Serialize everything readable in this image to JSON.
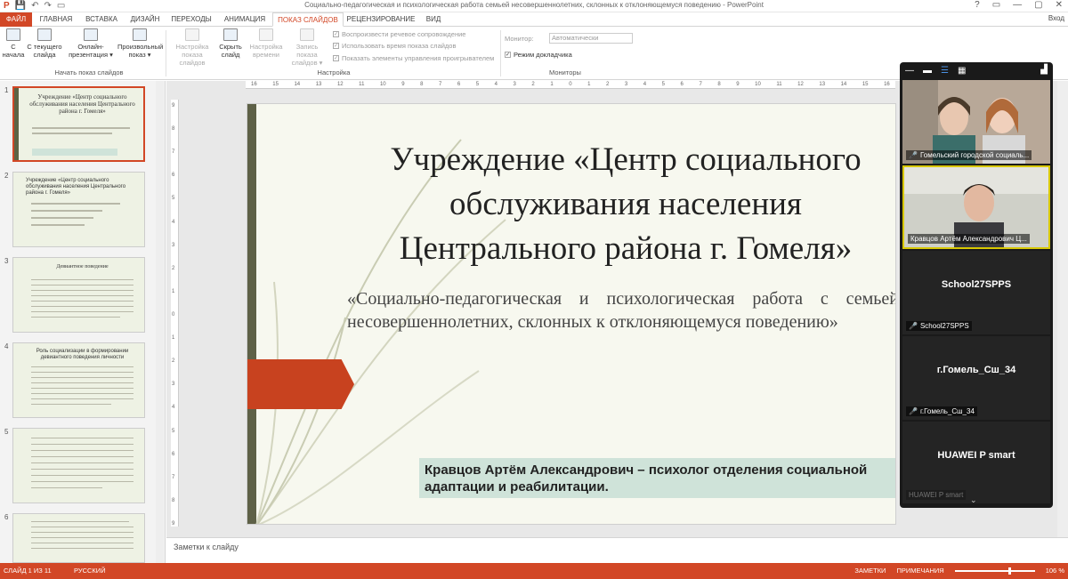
{
  "titlebar": {
    "qat_icons": [
      "P",
      "💾",
      "↶",
      "↷",
      "▭"
    ],
    "title": "Социально-педагогическая и психологическая работа семьей несовершеннолетних, склонных к отклоняющемуся поведению - PowerPoint",
    "win_controls": [
      "?",
      "▭",
      "—",
      "▢",
      "✕"
    ]
  },
  "tabs": {
    "file": "ФАЙЛ",
    "items": [
      "ГЛАВНАЯ",
      "ВСТАВКА",
      "ДИЗАЙН",
      "ПЕРЕХОДЫ",
      "АНИМАЦИЯ",
      "ПОКАЗ СЛАЙДОВ",
      "РЕЦЕНЗИРОВАНИЕ",
      "ВИД"
    ],
    "login": "Вход"
  },
  "ribbon": {
    "btn_from_start": "С\nначала",
    "btn_from_current": "С текущего\nслайда",
    "btn_online": "Онлайн-\nпрезентация ▾",
    "btn_custom": "Произвольный\nпоказ ▾",
    "group_start": "Начать показ слайдов",
    "btn_setup": "Настройка\nпоказа слайдов",
    "btn_hide": "Скрыть\nслайд",
    "btn_rehearse": "Настройка\nвремени",
    "btn_record": "Запись показа\nслайдов ▾",
    "chk_narration": "Воспроизвести речевое сопровождение",
    "chk_timings": "Использовать время показа слайдов",
    "chk_controls": "Показать элементы управления проигрывателем",
    "group_setup": "Настройка",
    "monitor_label": "Монитор:",
    "monitor_value": "Автоматически",
    "presenter_view": "Режим докладчика",
    "group_monitors": "Мониторы"
  },
  "thumbs": [
    {
      "num": "1",
      "title": "Учреждение «Центр социального обслуживания населения Центрального района г. Гомеля»"
    },
    {
      "num": "2",
      "title": "Учреждение «Центр социального обслуживания населения Центрального района г. Гомеля»"
    },
    {
      "num": "3",
      "title": "Девиантное поведение"
    },
    {
      "num": "4",
      "title": "Роль социализации в формировании девиантного поведения личности"
    },
    {
      "num": "5",
      "title": ""
    },
    {
      "num": "6",
      "title": ""
    }
  ],
  "ruler_h": [
    "16",
    "15",
    "14",
    "13",
    "12",
    "11",
    "10",
    "9",
    "8",
    "7",
    "6",
    "5",
    "4",
    "3",
    "2",
    "1",
    "0",
    "1",
    "2",
    "3",
    "4",
    "5",
    "6",
    "7",
    "8",
    "9",
    "10",
    "11",
    "12",
    "13",
    "14",
    "15",
    "16"
  ],
  "ruler_v": [
    "9",
    "8",
    "7",
    "6",
    "5",
    "4",
    "3",
    "2",
    "1",
    "0",
    "1",
    "2",
    "3",
    "4",
    "5",
    "6",
    "7",
    "8",
    "9"
  ],
  "slide": {
    "title": "Учреждение «Центр социального обслуживания населения Центрального района г. Гомеля»",
    "subtitle": "«Социально-педагогическая и психологическая работа с семьей несовершеннолетних, склонных к отклоняющемуся поведению»",
    "author": "Кравцов Артём Александрович – психолог отделения социальной адаптации и реабилитации."
  },
  "notes": "Заметки к слайду",
  "status": {
    "slide": "СЛАЙД 1 ИЗ 11",
    "lang": "РУССКИЙ",
    "notes": "ЗАМЕТКИ",
    "comments": "ПРИМЕЧАНИЯ",
    "zoom": "106 %"
  },
  "zoom": {
    "top_icons": [
      "—",
      "▬",
      "☰",
      "▦"
    ],
    "participants": [
      {
        "name": "Гомельский городской социаль...",
        "video": true
      },
      {
        "name": "Кравцов Артём Александрович Ц...",
        "video": true,
        "active": true
      },
      {
        "name": "School27SPPS",
        "big": "School27SPPS"
      },
      {
        "name": "г.Гомель_Сш_34",
        "big": "г.Гомель_Сш_34"
      },
      {
        "name": "HUAWEI P smart",
        "big": "HUAWEI P smart"
      }
    ]
  }
}
